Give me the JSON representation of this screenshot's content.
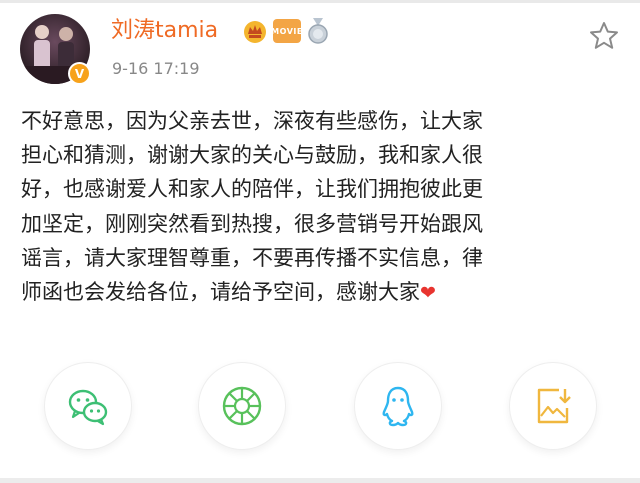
{
  "post": {
    "username": "刘涛tamia",
    "timestamp": "9-16 17:19",
    "badge_movie": "MOVIE",
    "verified_mark": "V",
    "lines": [
      "不好意思，因为父亲去世，深夜有些感伤，让大家",
      "担心和猜测，谢谢大家的关心与鼓励，我和家人很",
      "好，也感谢爱人和家人的陪伴，让我们拥抱彼此更",
      "加坚定，刚刚突然看到热搜，很多营销号开始跟风",
      "谣言，请大家理智尊重，不要再传播不实信息，律",
      "师函也会发给各位，请给予空间，感谢大家"
    ],
    "heart": "❤"
  },
  "share_icons": [
    "wechat-icon",
    "moments-icon",
    "qq-icon",
    "save-image-icon"
  ],
  "colors": {
    "username": "#ef6a24",
    "wechat": "#3dbf74",
    "moments": "#58c15b",
    "qq": "#2eb6f0",
    "save": "#f0b73e"
  }
}
